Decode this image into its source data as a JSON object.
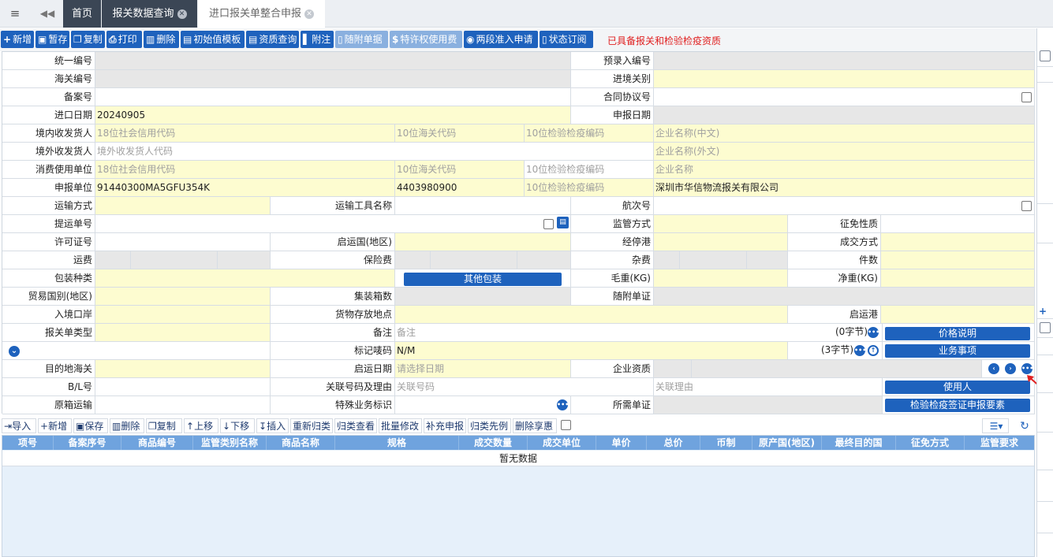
{
  "tabs": {
    "first": "首页",
    "second": "报关数据查询",
    "third": "进口报关单整合申报"
  },
  "toolbar": {
    "new": "新增",
    "save_draft": "暂存",
    "copy": "复制",
    "print": "打印",
    "delete": "删除",
    "init_template": "初始值模板",
    "qualification_query": "资质查询",
    "attachment": "附注",
    "attached_docs": "随附单据",
    "royalty_fee": "特许权使用费",
    "two_stage": "两段准入申请",
    "status_subscribe": "状态订阅",
    "warning": "已具备报关和检验检疫资质"
  },
  "form": {
    "unified_no": "统一编号",
    "pre_entry_no": "预录入编号",
    "customs_no": "海关编号",
    "entry_customs": "进境关别",
    "record_no": "备案号",
    "contract_no": "合同协议号",
    "import_date": "进口日期",
    "import_date_value": "20240905",
    "declare_date": "申报日期",
    "domestic_consignee": "境内收发货人",
    "credit_code_ph": "18位社会信用代码",
    "customs_code_ph": "10位海关代码",
    "ciq_code_ph": "10位检验检疫编码",
    "company_cn_ph": "企业名称(中文)",
    "foreign_consignee": "境外收发货人",
    "foreign_code_ph": "境外收发货人代码",
    "company_en_ph": "企业名称(外文)",
    "consumer_unit": "消费使用单位",
    "company_name_ph": "企业名称",
    "declare_unit": "申报单位",
    "declare_unit_credit": "91440300MA5GFU354K",
    "declare_unit_customs": "4403980900",
    "declare_unit_name": "深圳市华信物流报关有限公司",
    "transport_mode": "运输方式",
    "transport_tool": "运输工具名称",
    "voyage_no": "航次号",
    "bill_no": "提运单号",
    "supervision_mode": "监管方式",
    "levy_nature": "征免性质",
    "license_no": "许可证号",
    "departure_country": "启运国(地区)",
    "transit_port": "经停港",
    "deal_mode": "成交方式",
    "freight": "运费",
    "insurance": "保险费",
    "misc_fee": "杂费",
    "pieces": "件数",
    "package_type": "包装种类",
    "other_package_btn": "其他包装",
    "gross_weight": "毛重(KG)",
    "net_weight": "净重(KG)",
    "trade_country": "贸易国别(地区)",
    "container_count": "集装箱数",
    "attached_cert": "随附单证",
    "entry_port": "入境口岸",
    "goods_location": "货物存放地点",
    "departure_port": "启运港",
    "declaration_type": "报关单类型",
    "remark": "备注",
    "remark_ph": "备注",
    "remark_count": "(0字节)",
    "price_desc_btn": "价格说明",
    "mark_no": "标记唛码",
    "mark_value": "N/M",
    "mark_count": "(3字节)",
    "business_btn": "业务事项",
    "dest_customs": "目的地海关",
    "departure_date": "启运日期",
    "departure_date_ph": "请选择日期",
    "company_qualification": "企业资质",
    "bl_no": "B/L号",
    "related_no_reason": "关联号码及理由",
    "related_no_ph": "关联号码",
    "related_reason_ph": "关联理由",
    "user_btn": "使用人",
    "origin_transport": "原箱运输",
    "special_business": "特殊业务标识",
    "required_cert": "所需单证",
    "ciq_cert_btn": "检验检疫签证申报要素"
  },
  "grid_toolbar": {
    "import": "导入",
    "new": "新增",
    "save": "保存",
    "delete": "删除",
    "copy": "复制",
    "move_up": "上移",
    "move_down": "下移",
    "insert": "插入",
    "reclassify": "重新归类",
    "classify_view": "归类查看",
    "batch_edit": "批量修改",
    "supplement": "补充申报",
    "classify_precedent": "归类先例",
    "delete_benefit": "删除享惠"
  },
  "grid": {
    "columns": [
      "项号",
      "备案序号",
      "商品编号",
      "监管类别名称",
      "商品名称",
      "规格",
      "成交数量",
      "成交单位",
      "单价",
      "总价",
      "币制",
      "原产国(地区)",
      "最终目的国",
      "征免方式",
      "监管要求"
    ],
    "empty_text": "暂无数据"
  }
}
